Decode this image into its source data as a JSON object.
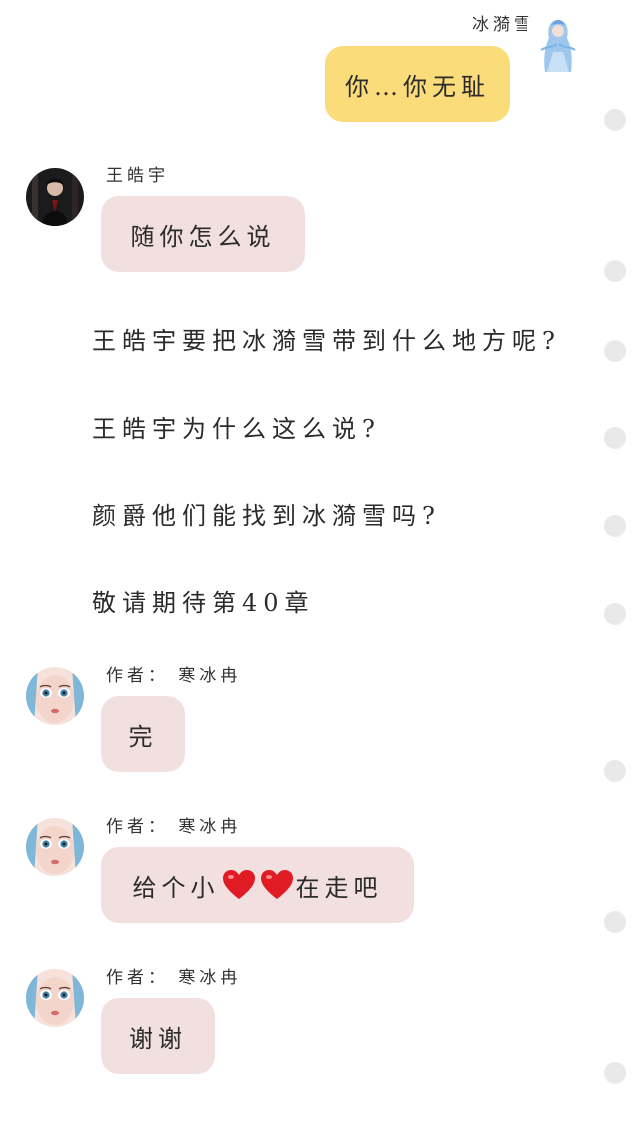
{
  "messages": [
    {
      "sender": "冰漪雪",
      "text": "你…你无耻"
    },
    {
      "sender": "王皓宇",
      "text": "随你怎么说"
    },
    {
      "sender": "作者：  寒冰冉",
      "text": "完"
    },
    {
      "sender": "作者：  寒冰冉",
      "text_before": "给个小",
      "text_after": "在走吧"
    },
    {
      "sender": "作者：  寒冰冉",
      "text": "谢谢"
    }
  ],
  "narration": [
    "王皓宇要把冰漪雪带到什么地方呢?",
    "王皓宇为什么这么说?",
    "颜爵他们能找到冰漪雪吗?",
    "敬请期待第40章"
  ],
  "icons": {
    "hearts": "heart-emoji",
    "avatars": [
      "ice-princess-avatar",
      "man-in-black-avatar",
      "doll-face-avatar"
    ]
  },
  "colors": {
    "self_bubble": "#fbdc7a",
    "other_bubble": "#f2dfdf",
    "scroll_dot": "#e9e9e9"
  }
}
